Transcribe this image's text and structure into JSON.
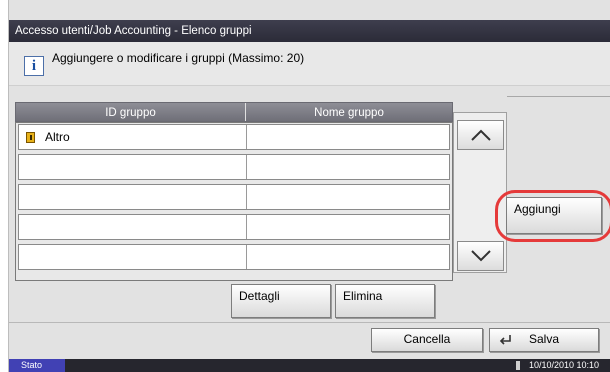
{
  "window": {
    "title": "Accesso utenti/Job Accounting - Elenco gruppi"
  },
  "message": {
    "icon": "info-icon",
    "text": "Aggiungere o modificare i gruppi (Massimo: 20)"
  },
  "table": {
    "columns": [
      "ID gruppo",
      "Nome gruppo"
    ],
    "rows": [
      {
        "id": "Altro",
        "name": ""
      },
      {
        "id": "",
        "name": ""
      },
      {
        "id": "",
        "name": ""
      },
      {
        "id": "",
        "name": ""
      },
      {
        "id": "",
        "name": ""
      }
    ]
  },
  "buttons": {
    "add": "Aggiungi",
    "details": "Dettagli",
    "delete": "Elimina",
    "cancel": "Cancella",
    "save": "Salva"
  },
  "status": {
    "label": "Stato",
    "datetime": "10/10/2010  10:10"
  },
  "colors": {
    "highlight": "#e53a3a",
    "titlebar": "#2b2b38",
    "status_tag": "#4141b4"
  }
}
